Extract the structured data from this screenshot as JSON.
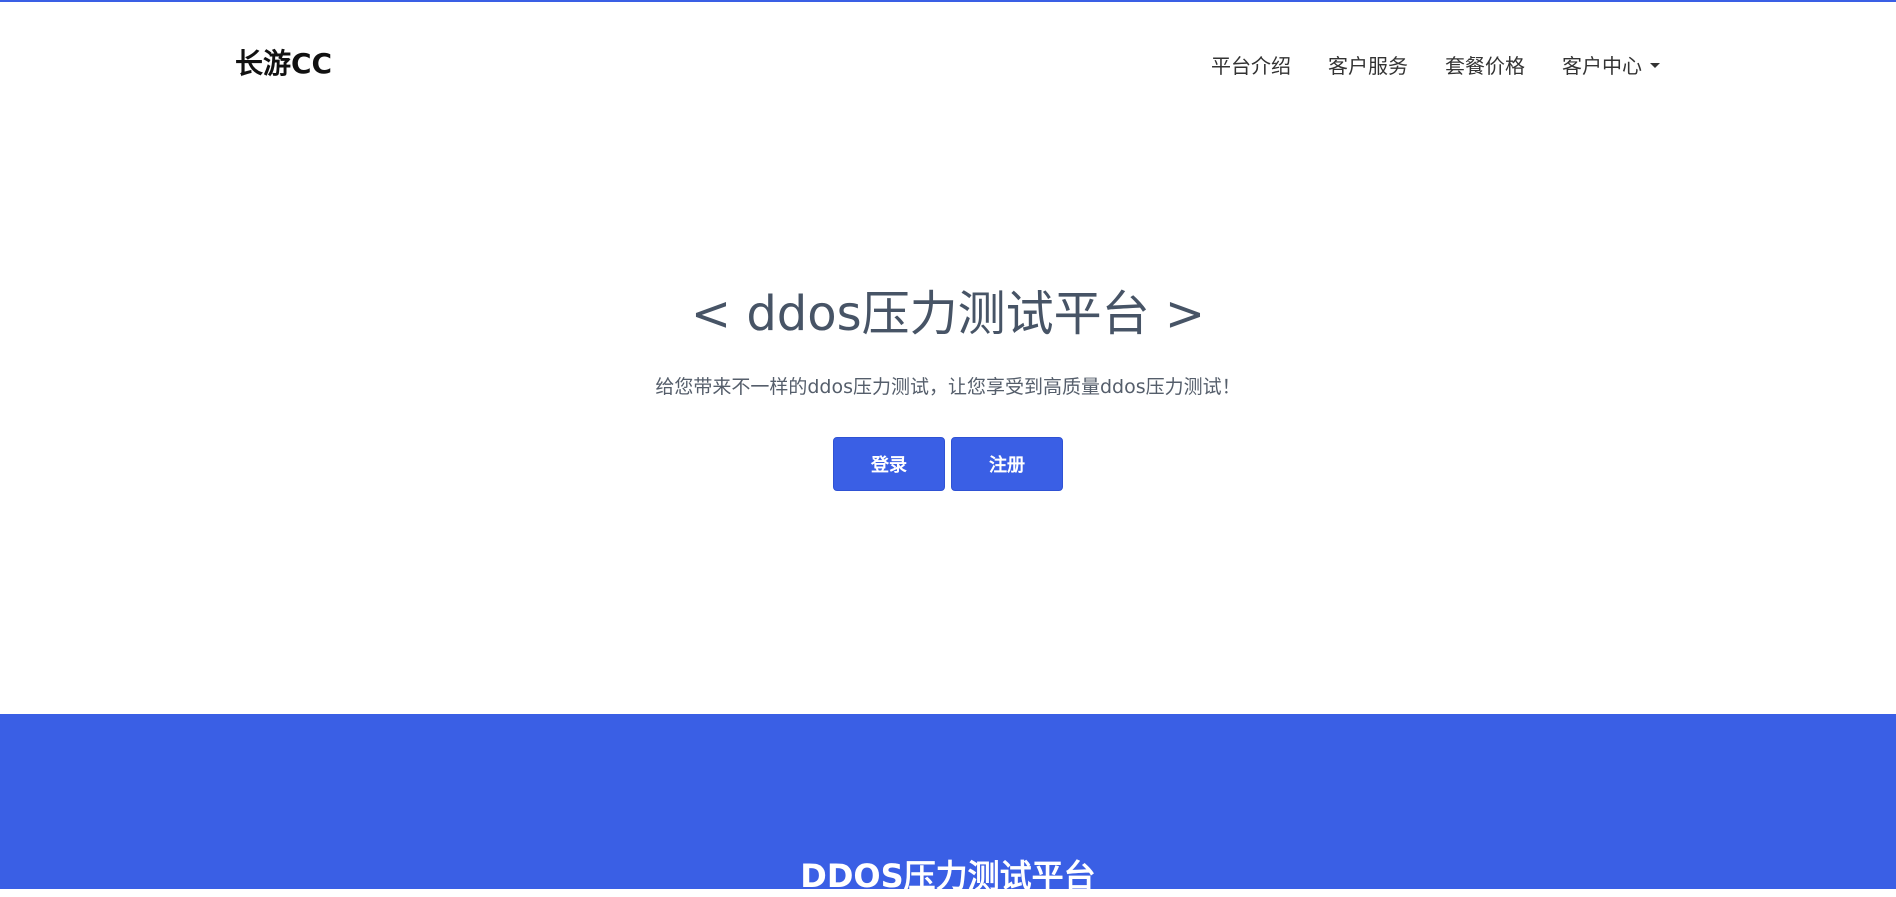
{
  "colors": {
    "accent": "#3a5fe5",
    "text_dark": "#111111",
    "hero_title": "#475466",
    "hero_subtitle": "#555e6b"
  },
  "header": {
    "brand": "长游CC",
    "nav": [
      {
        "label": "平台介绍"
      },
      {
        "label": "客户服务"
      },
      {
        "label": "套餐价格"
      },
      {
        "label": "客户中心",
        "icon": "caret-down-icon"
      }
    ]
  },
  "hero": {
    "title": "< ddos压力测试平台 >",
    "subtitle": "给您带来不一样的ddos压力测试，让您享受到高质量ddos压力测试！",
    "buttons": {
      "login": "登录",
      "register": "注册"
    }
  },
  "feature_section": {
    "title": "DDOS压力测试平台"
  }
}
